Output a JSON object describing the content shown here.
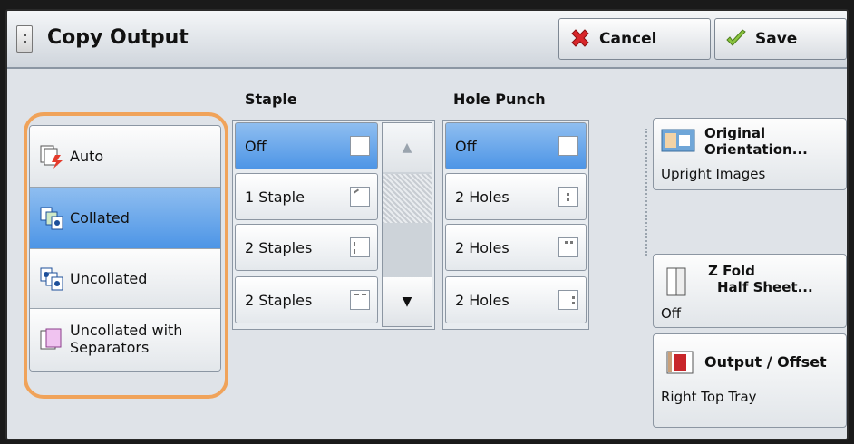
{
  "header": {
    "title": "Copy Output",
    "cancel_label": "Cancel",
    "save_label": "Save"
  },
  "output_options": {
    "items": [
      {
        "label": "Auto",
        "icon": "auto-collate-icon",
        "selected": false
      },
      {
        "label": "Collated",
        "icon": "collated-icon",
        "selected": true
      },
      {
        "label": "Uncollated",
        "icon": "uncollated-icon",
        "selected": false
      },
      {
        "label_line1": "Uncollated with",
        "label_line2": "Separators",
        "icon": "separators-icon",
        "selected": false
      }
    ]
  },
  "staple": {
    "title": "Staple",
    "options": [
      {
        "label": "Off",
        "icon": "blank-box-icon",
        "selected": true
      },
      {
        "label": "1 Staple",
        "icon": "staple-corner-icon",
        "selected": false
      },
      {
        "label": "2 Staples",
        "icon": "staple-left-icon",
        "selected": false
      },
      {
        "label": "2 Staples",
        "icon": "staple-top-icon",
        "selected": false
      }
    ]
  },
  "hole_punch": {
    "title": "Hole Punch",
    "options": [
      {
        "label": "Off",
        "icon": "blank-box-icon",
        "selected": true
      },
      {
        "label": "2 Holes",
        "icon": "holes-left-icon",
        "selected": false
      },
      {
        "label": "2 Holes",
        "icon": "holes-top-icon",
        "selected": false
      },
      {
        "label": "2 Holes",
        "icon": "holes-right-icon",
        "selected": false
      }
    ]
  },
  "original_orientation": {
    "label_line1": "Original",
    "label_line2": "Orientation...",
    "value": "Upright Images"
  },
  "z_fold": {
    "label_line1": "Z Fold",
    "label_line2": "Half Sheet...",
    "value": "Off"
  },
  "output_offset": {
    "label": "Output / Offset",
    "value": "Right Top Tray"
  },
  "colors": {
    "selected": "#4d95e6",
    "highlight_ring": "#f0a35a",
    "cancel_icon": "#d8262a",
    "save_icon": "#8ac43f"
  }
}
